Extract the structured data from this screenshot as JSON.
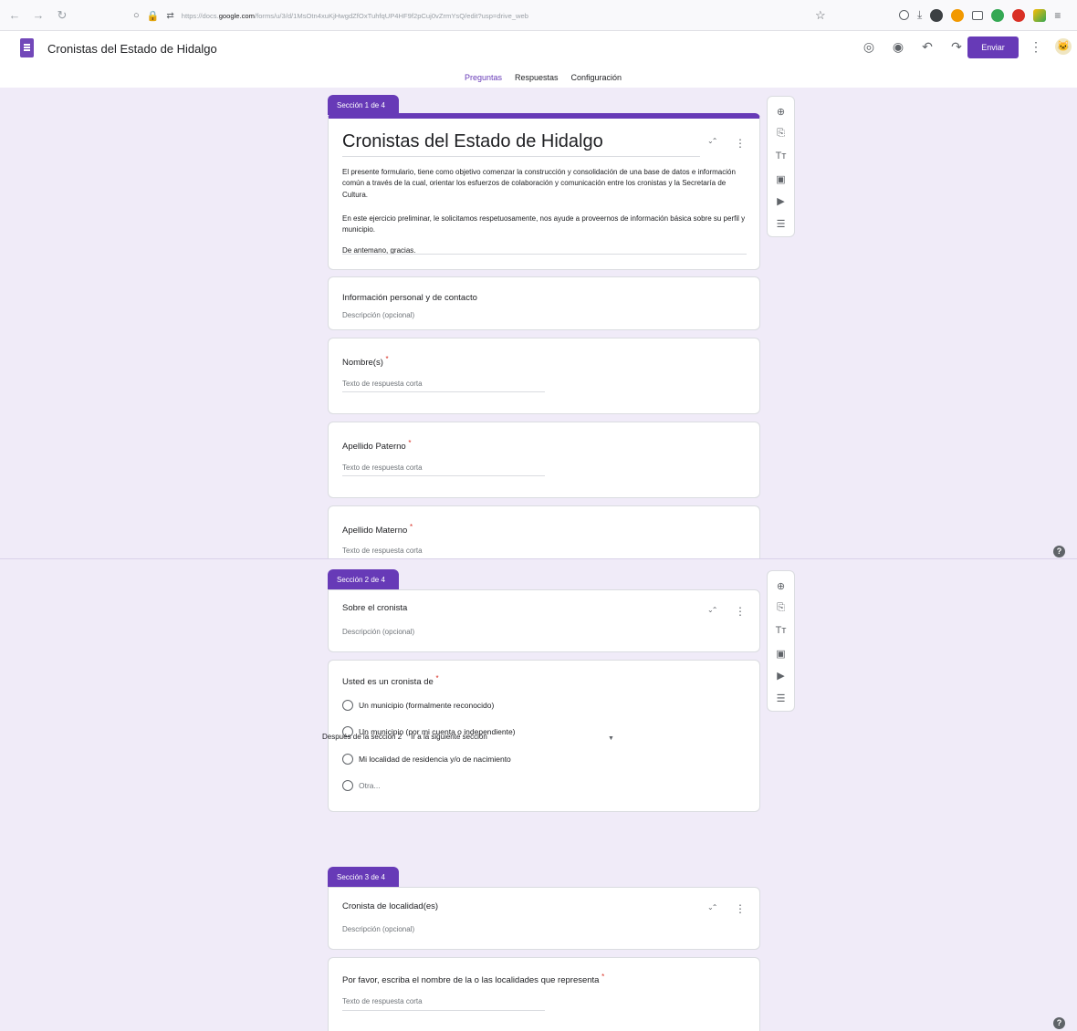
{
  "browser": {
    "back_icon": "arrow-left",
    "forward_icon": "arrow-right",
    "reload_icon": "reload",
    "url_prefix": "https://docs.",
    "url_domain": "google.com",
    "url_rest": "/forms/u/3/d/1MsOtn4xuKjHwgdZfOxTuhfqUP4HF9f2pCuj0vZrmYsQ/edit?usp=drive_web"
  },
  "app": {
    "title": "Cronistas del Estado de Hidalgo",
    "send_label": "Enviar",
    "accent": "#673ab7",
    "tabs": [
      {
        "label": "Preguntas",
        "active": true
      },
      {
        "label": "Respuestas",
        "active": false
      },
      {
        "label": "Configuración",
        "active": false
      }
    ]
  },
  "section1": {
    "tag": "Sección 1 de 4",
    "form_title": "Cronistas del Estado de Hidalgo",
    "description_p1": "El presente formulario, tiene como objetivo comenzar la construcción y consolidación de una base de datos e información común a través de la cual, orientar los esfuerzos de colaboración y comunicación entre los cronistas y la Secretaría de Cultura.",
    "description_p2": "En este ejercicio preliminar, le solicitamos respetuosamente, nos ayude a proveernos de información básica sobre su perfil y municipio.",
    "description_p3": "De antemano, gracias.",
    "info_block": {
      "title": "Información personal y de contacto",
      "description": "Descripción (opcional)"
    },
    "questions": [
      {
        "title": "Nombre(s)",
        "required_mark": "*",
        "placeholder": "Texto de respuesta corta"
      },
      {
        "title": "Apellido Paterno",
        "required_mark": "*",
        "placeholder": "Texto de respuesta corta"
      },
      {
        "title": "Apellido Materno",
        "required_mark": "*",
        "placeholder": "Texto de respuesta corta"
      }
    ]
  },
  "section2": {
    "tag": "Sección 2 de 4",
    "title": "Sobre el cronista",
    "description": "Descripción (opcional)",
    "question": {
      "title": "Usted es un cronista de",
      "required_mark": "*",
      "options": [
        "Un municipio (formalmente reconocido)",
        "Un municipio (por mi cuenta o independiente)",
        "Mi localidad de residencia y/o de nacimiento"
      ],
      "other_option": "Otra..."
    },
    "after_label": "Después de la sección 2",
    "after_value": "Ir a la siguiente sección"
  },
  "section3": {
    "tag": "Sección 3 de 4",
    "title": "Cronista de localidad(es)",
    "description": "Descripción (opcional)",
    "question": {
      "title": "Por favor, escriba el nombre de la o las localidades que representa",
      "required_mark": "*",
      "placeholder": "Texto de respuesta corta"
    }
  },
  "toolbar": {
    "items": [
      "add-question-icon",
      "import-questions-icon",
      "add-title-icon",
      "add-image-icon",
      "add-video-icon",
      "add-section-icon"
    ],
    "glyphs": [
      "⊕",
      "⎘",
      "Tт",
      "▣",
      "▶",
      "☰"
    ]
  },
  "glyphs": {
    "collapse": "⌄⌃",
    "kebab": "⋮",
    "help": "?",
    "dropdown": "▼",
    "star": "☆",
    "palette": "◎",
    "preview": "◉",
    "undo": "↶",
    "redo": "↷",
    "avatar": "🐱"
  }
}
